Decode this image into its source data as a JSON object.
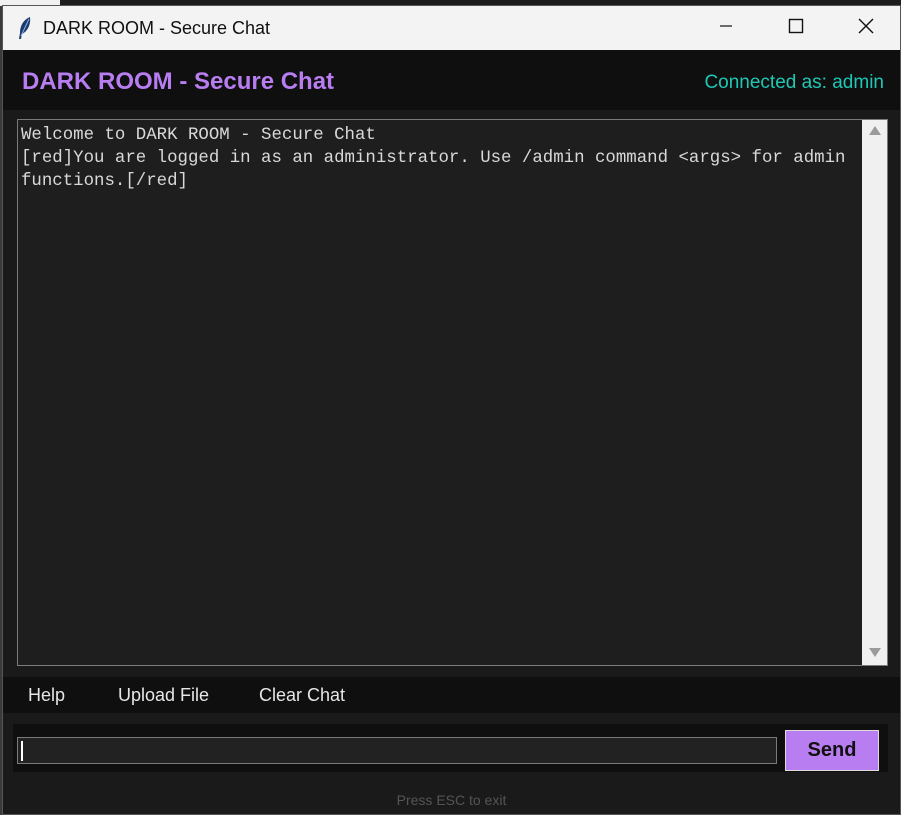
{
  "window": {
    "title": "DARK ROOM - Secure Chat"
  },
  "header": {
    "app_title": "DARK ROOM - Secure Chat",
    "connection_status": "Connected as: admin"
  },
  "chat": {
    "messages": [
      "Welcome to DARK ROOM - Secure Chat",
      "[red]You are logged in as an administrator. Use /admin command <args> for admin functions.[/red]"
    ]
  },
  "toolbar": {
    "help_label": "Help",
    "upload_label": "Upload File",
    "clear_label": "Clear Chat"
  },
  "composer": {
    "value": "",
    "send_label": "Send"
  },
  "footer": {
    "hint": "Press ESC to exit"
  },
  "colors": {
    "accent": "#b87df0",
    "status": "#1fc7b4",
    "background": "#1a1a1a"
  },
  "icons": {
    "app_icon": "feather-icon",
    "minimize": "minimize-icon",
    "maximize": "maximize-icon",
    "close": "close-icon"
  }
}
